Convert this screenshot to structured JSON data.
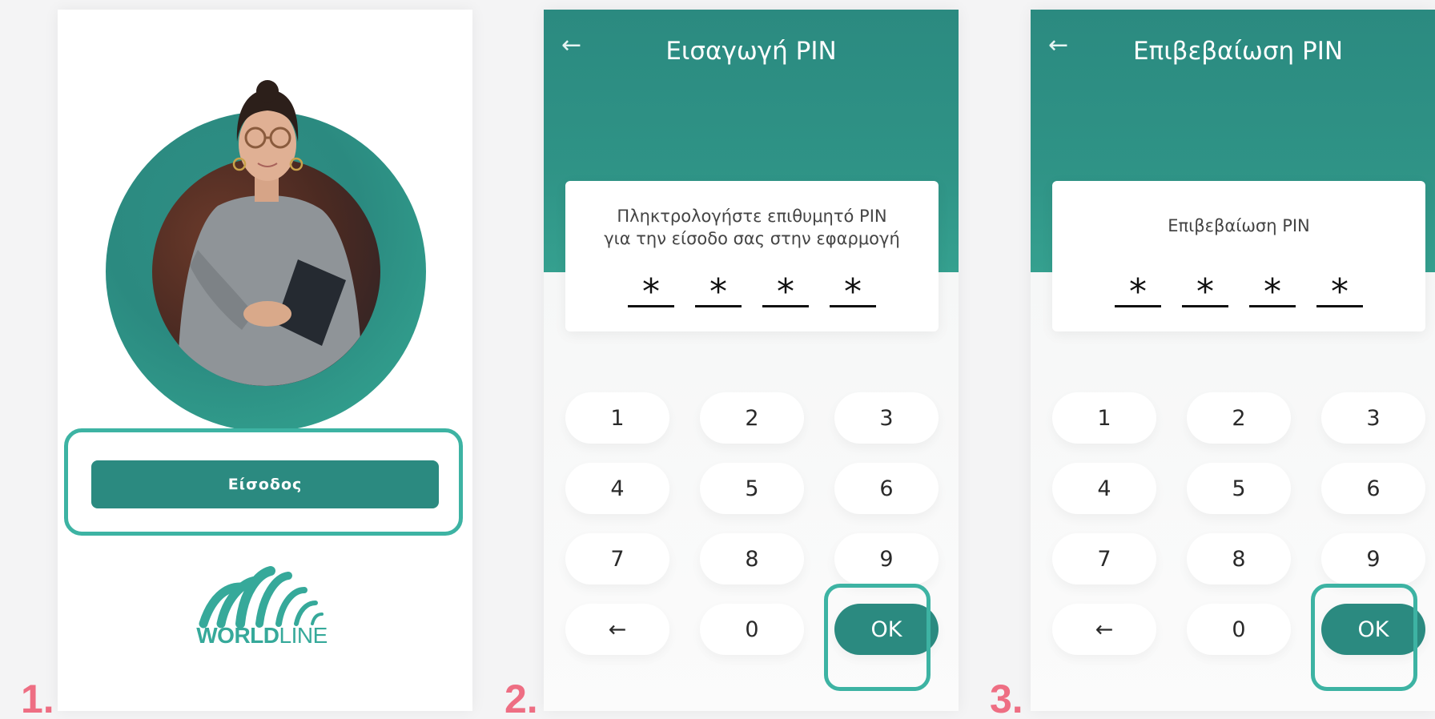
{
  "steps": [
    "1.",
    "2.",
    "3."
  ],
  "screen1": {
    "login_label": "Είσοδος",
    "logo_bold": "WORLD",
    "logo_light": "LINE"
  },
  "screen2": {
    "back_icon": "←",
    "title": "Εισαγωγή PIN",
    "prompt_line1": "Πληκτρολογήστε επιθυμητό PIN",
    "prompt_line2": "για την είσοδο σας στην εφαρμογή",
    "pin": [
      "*",
      "*",
      "*",
      "*"
    ]
  },
  "screen3": {
    "back_icon": "←",
    "title": "Επιβεβαίωση PIN",
    "prompt_line1": "Επιβεβαίωση PIN",
    "pin": [
      "*",
      "*",
      "*",
      "*"
    ]
  },
  "keypad": {
    "k1": "1",
    "k2": "2",
    "k3": "3",
    "k4": "4",
    "k5": "5",
    "k6": "6",
    "k7": "7",
    "k8": "8",
    "k9": "9",
    "back": "←",
    "k0": "0",
    "ok": "OK"
  },
  "colors": {
    "brand_teal": "#2b8a80",
    "highlight": "#3db3a3",
    "step_number": "#ee6e83"
  }
}
